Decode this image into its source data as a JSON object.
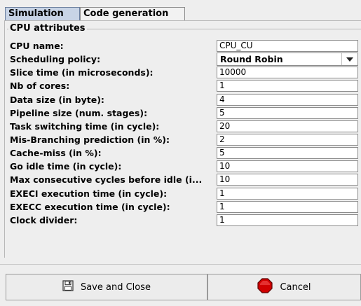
{
  "tabs": [
    {
      "label": "Simulation"
    },
    {
      "label": "Code generation"
    }
  ],
  "group": {
    "title": "CPU attributes"
  },
  "fields": [
    {
      "label": "CPU name:",
      "value": "CPU_CU"
    },
    {
      "label": "Scheduling policy:",
      "value": "Round Robin",
      "type": "select"
    },
    {
      "label": "Slice time (in microseconds):",
      "value": "10000"
    },
    {
      "label": "Nb of cores:",
      "value": "1"
    },
    {
      "label": "Data size (in byte):",
      "value": "4"
    },
    {
      "label": "Pipeline size (num. stages):",
      "value": "5"
    },
    {
      "label": "Task switching time (in cycle):",
      "value": "20"
    },
    {
      "label": "Mis-Branching prediction (in %):",
      "value": "2"
    },
    {
      "label": "Cache-miss (in %):",
      "value": "5"
    },
    {
      "label": "Go idle time (in cycle):",
      "value": "10"
    },
    {
      "label": "Max consecutive cycles before idle (i...",
      "value": "10"
    },
    {
      "label": "EXECI execution time (in cycle):",
      "value": "1"
    },
    {
      "label": "EXECC execution time (in cycle):",
      "value": "1"
    },
    {
      "label": "Clock divider:",
      "value": "1"
    }
  ],
  "buttons": {
    "save": {
      "label": "Save and Close",
      "icon": "floppy-disk-icon"
    },
    "cancel": {
      "label": "Cancel",
      "icon": "stop-sign-icon",
      "color": "#d00000"
    }
  }
}
